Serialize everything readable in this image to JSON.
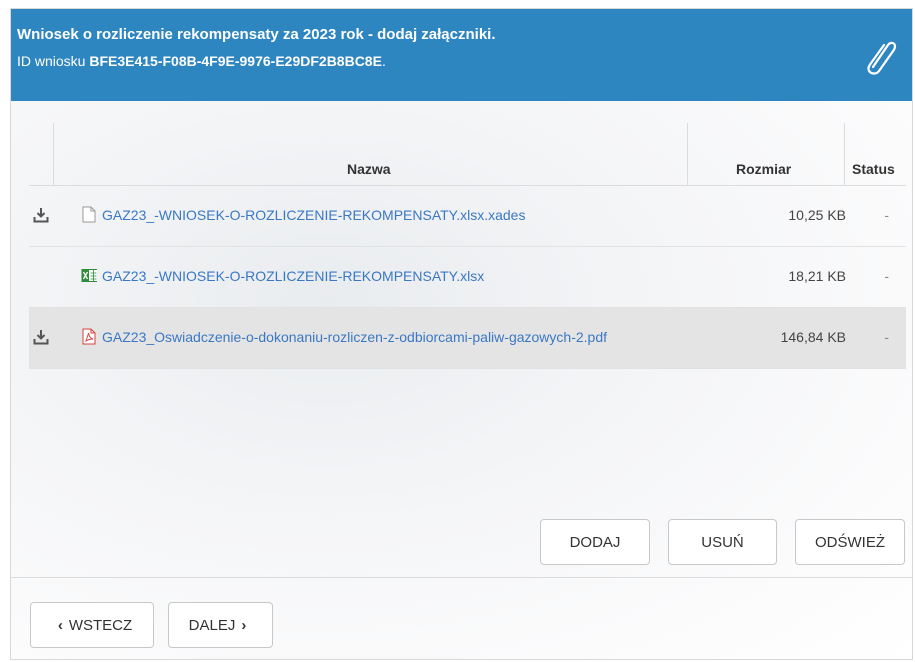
{
  "header": {
    "title": "Wniosek o rozliczenie rekompensaty za 2023 rok - dodaj załączniki.",
    "id_label": "ID wniosku",
    "id_value": "BFE3E415-F08B-4F9E-9976-E29DF2B8BC8E",
    "id_suffix": ".",
    "icon": "paperclip-icon"
  },
  "table": {
    "columns": {
      "name": "Nazwa",
      "size": "Rozmiar",
      "status": "Status"
    },
    "rows": [
      {
        "name": "GAZ23_-WNIOSEK-O-ROZLICZENIE-REKOMPENSATY.xlsx.xades",
        "size": "10,25 KB",
        "status": "-",
        "file_icon": "document-icon",
        "download": true
      },
      {
        "name": "GAZ23_-WNIOSEK-O-ROZLICZENIE-REKOMPENSATY.xlsx",
        "size": "18,21 KB",
        "status": "-",
        "file_icon": "excel-file-icon",
        "download": false
      },
      {
        "name": "GAZ23_Oswiadczenie-o-dokonaniu-rozliczen-z-odbiorcami-paliw-gazowych-2.pdf",
        "size": "146,84 KB",
        "status": "-",
        "file_icon": "pdf-file-icon",
        "download": true,
        "selected": true
      }
    ]
  },
  "actions": {
    "add": "DODAJ",
    "remove": "USUŃ",
    "refresh": "ODŚWIEŻ"
  },
  "nav": {
    "back": "WSTECZ",
    "next": "DALEJ"
  },
  "colors": {
    "header": "#2e86c1",
    "link": "#3a78c4",
    "selected_row": "#e4e4e4"
  }
}
